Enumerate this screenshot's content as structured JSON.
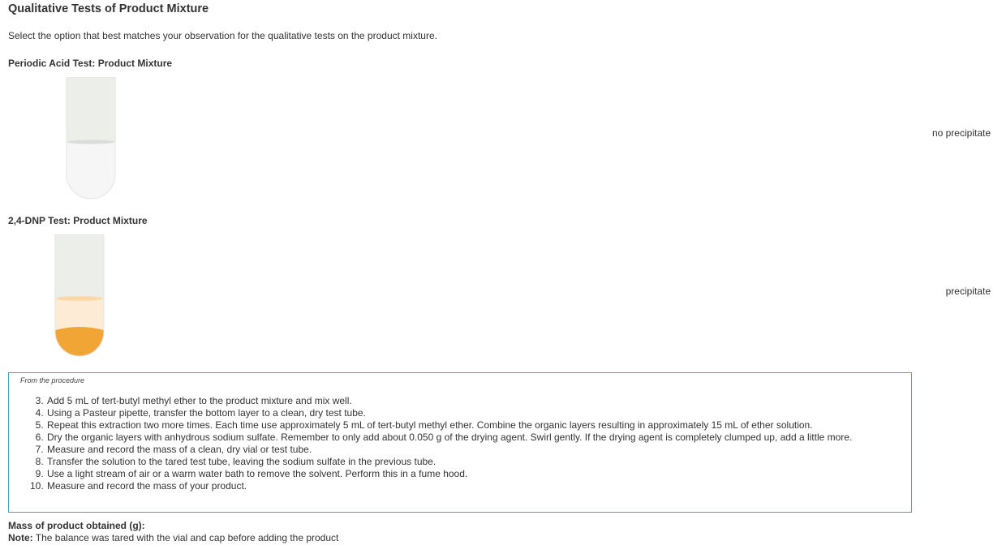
{
  "page": {
    "title": "Qualitative Tests of Product Mixture",
    "instructions": "Select the option that best matches your observation for the qualitative tests on the product mixture."
  },
  "tests": [
    {
      "heading": "Periodic Acid Test: Product Mixture",
      "observation": "no precipitate",
      "liquid_color": "#f5f5f5",
      "precipitate_color": null
    },
    {
      "heading": "2,4-DNP Test: Product Mixture",
      "observation": "precipitate",
      "liquid_color": "#fdebd6",
      "precipitate_color": "#f0a535"
    }
  ],
  "procedure": {
    "heading": "From the procedure",
    "steps": [
      "Add 5 mL of tert-butyl methyl ether to the product mixture and mix well.",
      "Using a Pasteur pipette, transfer the bottom layer to a clean, dry test tube.",
      "Repeat this extraction two more times. Each time use approximately 5 mL of tert-butyl methyl ether. Combine the organic layers resulting in approximately 15 mL of ether solution.",
      "Dry the organic layers with anhydrous sodium sulfate. Remember to only add about 0.050 g of the drying agent. Swirl gently. If the drying agent is completely clumped up, add a little more.",
      "Measure and record the mass of a clean, dry vial or test tube.",
      "Transfer the solution to the tared test tube, leaving the sodium sulfate in the previous tube.",
      "Use a light stream of air or a warm water bath to remove the solvent. Perform this in a fume hood.",
      "Measure and record the mass of your product."
    ]
  },
  "mass": {
    "label": "Mass of product obtained (g):",
    "note_label": "Note:",
    "note_text": " The balance was tared with the vial and cap before adding the product"
  },
  "colors": {
    "tube_glass": "#eceeea",
    "procedure_border": "#4a9fbf"
  }
}
